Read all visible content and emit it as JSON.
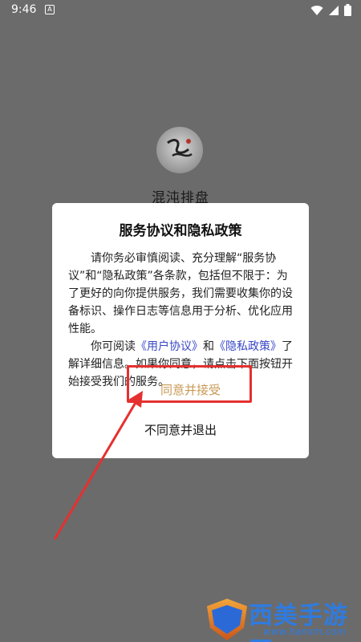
{
  "status_bar": {
    "time": "9:46",
    "notification_glyph": "A",
    "icons": [
      "wifi-icon",
      "signal-icon",
      "battery-icon"
    ]
  },
  "app": {
    "name": "混沌排盘",
    "logo_icon": "app-logo-icon"
  },
  "dialog": {
    "title": "服务协议和隐私政策",
    "paragraph1": "请你务必审慎阅读、充分理解“服务协议”和“隐私政策”各条款，包括但不限于：为了更好的向你提供服务，我们需要收集你的设备标识、操作日志等信息用于分析、优化应用性能。",
    "paragraph2_prefix": "你可阅读",
    "user_agreement_link": "《用户协议》",
    "and_text": "和",
    "privacy_policy_link": "《隐私政策》",
    "paragraph2_suffix": "了解详细信息。如果你同意，请点击下面按钮开始接受我们的服务。",
    "agree_label": "同意并接受",
    "disagree_label": "不同意并退出"
  },
  "annotation": {
    "box_color": "#e53030",
    "arrow_color": "#e53030"
  },
  "watermark": {
    "text": "西美手游网",
    "url": "www.hanxm.com"
  },
  "colors": {
    "overlay": "#6b6b6b",
    "link": "#3747c6",
    "agree": "#c89a54",
    "dialog_bg": "#ffffff"
  }
}
